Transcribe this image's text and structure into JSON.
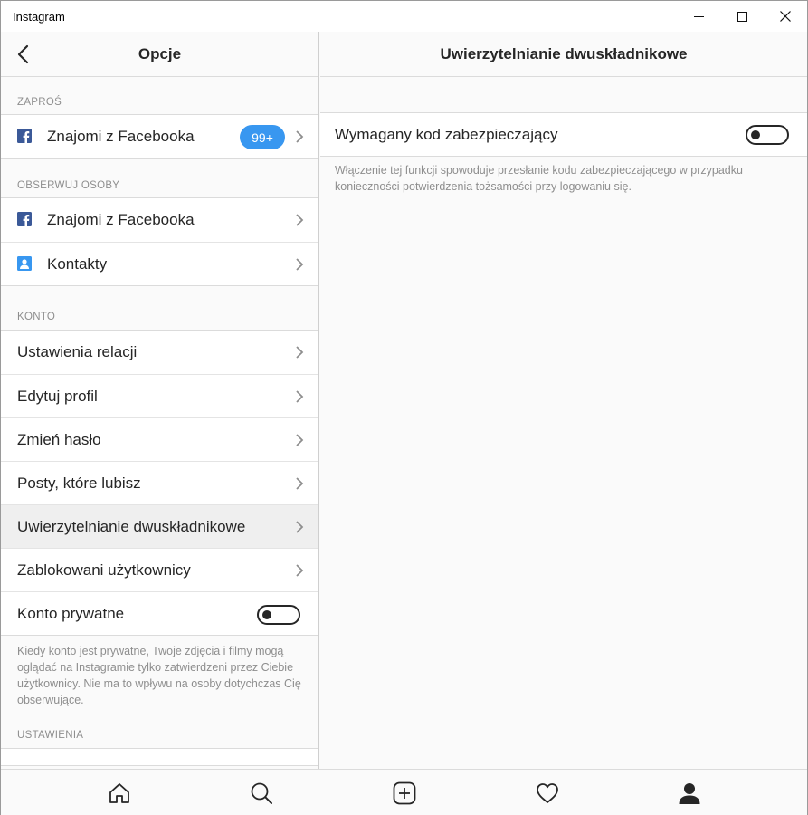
{
  "window": {
    "title": "Instagram"
  },
  "left": {
    "title": "Opcje",
    "sections": {
      "invite": {
        "label": "ZAPROŚ",
        "fb_label": "Znajomi z Facebooka",
        "badge": "99+"
      },
      "follow": {
        "label": "OBSERWUJ OSOBY",
        "fb_label": "Znajomi z Facebooka",
        "contacts_label": "Kontakty"
      },
      "account": {
        "label": "KONTO",
        "items": [
          "Ustawienia relacji",
          "Edytuj profil",
          "Zmień hasło",
          "Posty, które lubisz",
          "Uwierzytelnianie dwuskładnikowe",
          "Zablokowani użytkownicy"
        ],
        "private_label": "Konto prywatne",
        "private_enabled": false,
        "private_note": "Kiedy konto jest prywatne, Twoje zdjęcia i filmy mogą oglądać na Instagramie tylko zatwierdzeni przez Ciebie użytkownicy. Nie ma to wpływu na osoby dotychczas Cię obserwujące."
      },
      "settings": {
        "label": "USTAWIENIA"
      }
    }
  },
  "right": {
    "title": "Uwierzytelnianie dwuskładnikowe",
    "security_label": "Wymagany kod zabezpieczający",
    "security_enabled": false,
    "note": "Włączenie tej funkcji spowoduje przesłanie kodu zabezpieczającego w przypadku konieczności potwierdzenia tożsamości przy logowaniu się."
  },
  "bottom_nav": [
    "home-icon",
    "search-icon",
    "add-post-icon",
    "heart-icon",
    "profile-icon"
  ],
  "colors": {
    "accent": "#3897f0",
    "facebook": "#3b5998",
    "contacts": "#3897f0"
  }
}
